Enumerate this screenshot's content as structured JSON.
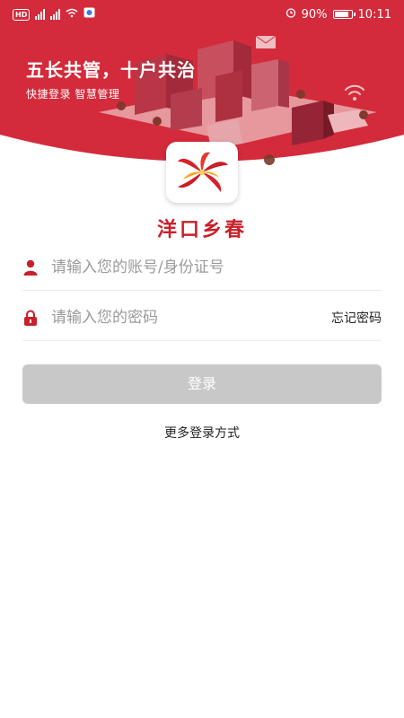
{
  "status": {
    "battery": "90%",
    "time": "10:11",
    "battery_level": 0.9
  },
  "hero": {
    "slogan": "五长共管，十户共治",
    "subtitle": "快捷登录 智慧管理",
    "bg_color": "#d32b3b"
  },
  "brand": {
    "name": "洋口乡春",
    "color": "#c8202a"
  },
  "form": {
    "account_placeholder": "请输入您的账号/身份证号",
    "password_placeholder": "请输入您的密码",
    "forgot_label": "忘记密码",
    "login_label": "登录",
    "more_label": "更多登录方式"
  },
  "icons": {
    "account": "user-icon",
    "password": "lock-icon",
    "logo": "flower-logo-icon"
  }
}
